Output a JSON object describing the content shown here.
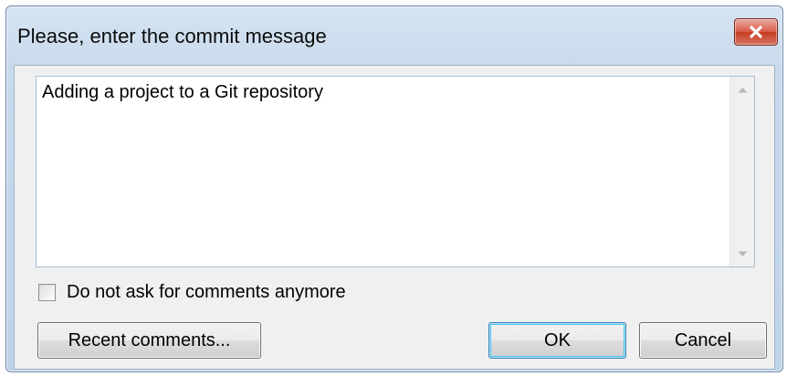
{
  "dialog": {
    "title": "Please, enter the commit message",
    "close_icon": "close-x-icon"
  },
  "message": {
    "value": "Adding a project to a Git repository"
  },
  "scrollbar": {
    "up_icon": "scroll-up-arrow-icon",
    "down_icon": "scroll-down-arrow-icon"
  },
  "checkbox": {
    "label": "Do not ask for comments anymore",
    "checked": false
  },
  "buttons": {
    "recent_label": "Recent comments...",
    "ok_label": "OK",
    "cancel_label": "Cancel"
  },
  "colors": {
    "close_button": "#c9452d",
    "default_button_glow": "#48c4f0",
    "window_frame": "#c8daec"
  }
}
